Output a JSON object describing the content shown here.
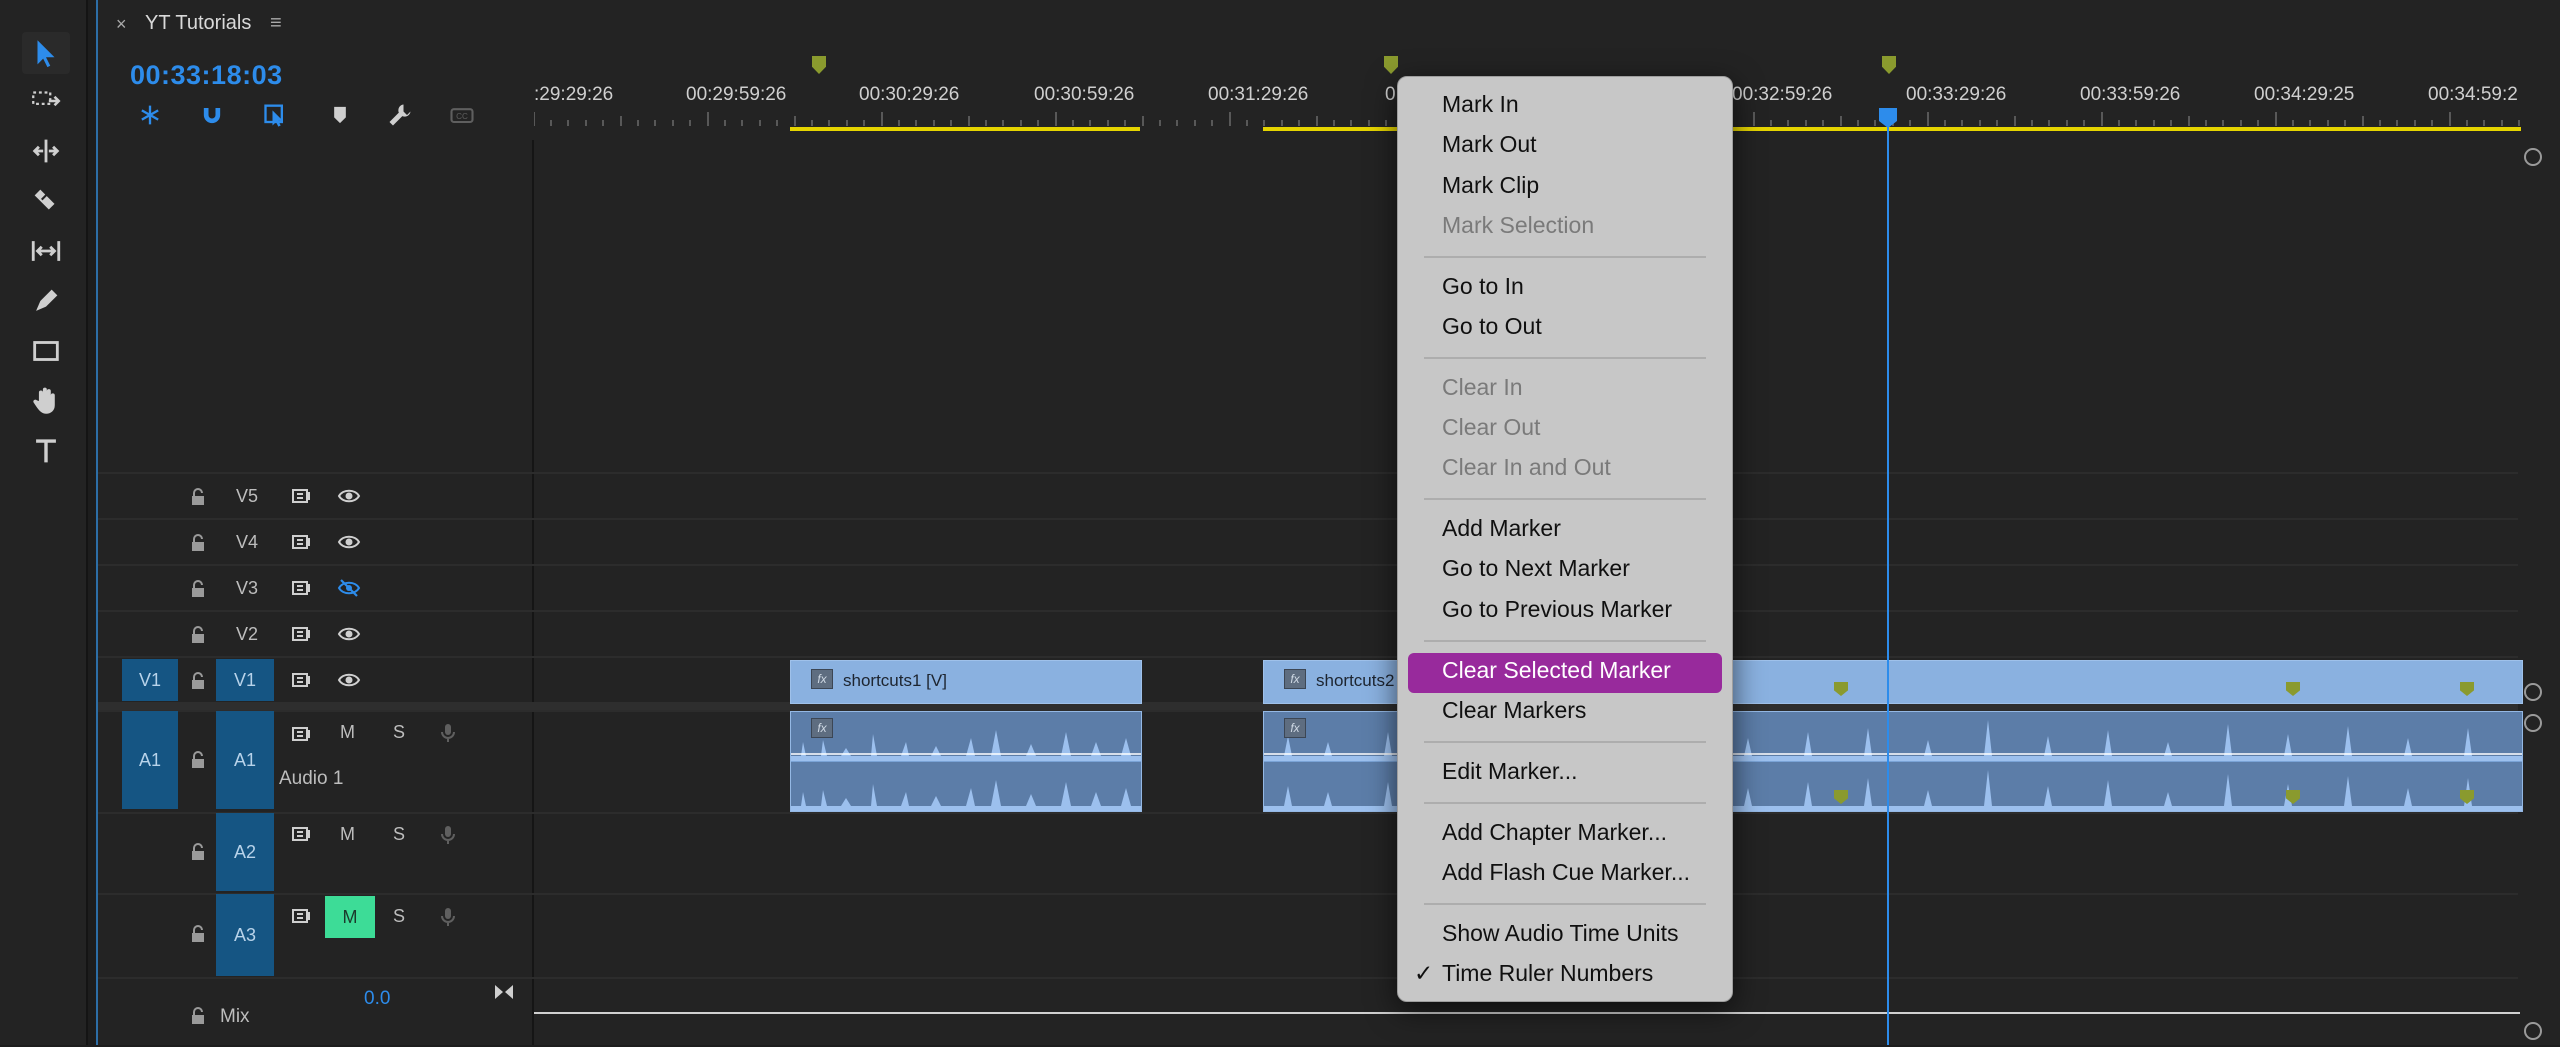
{
  "panel": {
    "tab_close": "×",
    "tab_title": "YT Tutorials",
    "tab_menu": "≡",
    "timecode": "00:33:18:03"
  },
  "ruler": {
    "ticks": [
      ":29:29:26",
      "00:29:59:26",
      "00:30:29:26",
      "00:30:59:26",
      "00:31:29:26",
      "00:32:59:26",
      "00:33:29:26",
      "00:33:59:26",
      "00:34:29:25",
      "00:34:59:2"
    ],
    "partial_tick": "0"
  },
  "tracks": {
    "video": [
      {
        "name": "V5",
        "visible": true
      },
      {
        "name": "V4",
        "visible": true
      },
      {
        "name": "V3",
        "visible": false
      },
      {
        "name": "V2",
        "visible": true
      },
      {
        "name": "V1",
        "visible": true,
        "source": "V1"
      }
    ],
    "audio": [
      {
        "name": "A1",
        "source": "A1",
        "label": "Audio 1",
        "mute": "M",
        "solo": "S"
      },
      {
        "name": "A2",
        "mute": "M",
        "solo": "S"
      },
      {
        "name": "A3",
        "mute": "M",
        "solo": "S",
        "mute_active": true
      }
    ],
    "mix_label": "Mix",
    "mix_value": "0.0"
  },
  "clips": {
    "clip1_name": "shortcuts1 [V]",
    "clip2_name": "shortcuts2",
    "fx": "fx"
  },
  "menu": {
    "items": [
      {
        "label": "Mark In",
        "enabled": true
      },
      {
        "label": "Mark Out",
        "enabled": true
      },
      {
        "label": "Mark Clip",
        "enabled": true
      },
      {
        "label": "Mark Selection",
        "enabled": false
      },
      {
        "label": "Go to In",
        "enabled": true
      },
      {
        "label": "Go to Out",
        "enabled": true
      },
      {
        "label": "Clear In",
        "enabled": false
      },
      {
        "label": "Clear Out",
        "enabled": false
      },
      {
        "label": "Clear In and Out",
        "enabled": false
      },
      {
        "label": "Add Marker",
        "enabled": true
      },
      {
        "label": "Go to Next Marker",
        "enabled": true
      },
      {
        "label": "Go to Previous Marker",
        "enabled": true
      },
      {
        "label": "Clear Selected Marker",
        "enabled": true,
        "highlighted": true
      },
      {
        "label": "Clear Markers",
        "enabled": true
      },
      {
        "label": "Edit Marker...",
        "enabled": true
      },
      {
        "label": "Add Chapter Marker...",
        "enabled": true
      },
      {
        "label": "Add Flash Cue Marker...",
        "enabled": true
      },
      {
        "label": "Show Audio Time Units",
        "enabled": true
      },
      {
        "label": "Time Ruler Numbers",
        "enabled": true,
        "checked": true
      }
    ],
    "checkmark": "✓"
  },
  "colors": {
    "accent_blue": "#2d8ceb",
    "highlight_purple": "#982a9c",
    "clip_blue": "#8ab1e0",
    "target_blue": "#155583",
    "mute_green": "#3ddc97",
    "marker_green": "#8a9a2e",
    "work_area_yellow": "#e5d400"
  }
}
